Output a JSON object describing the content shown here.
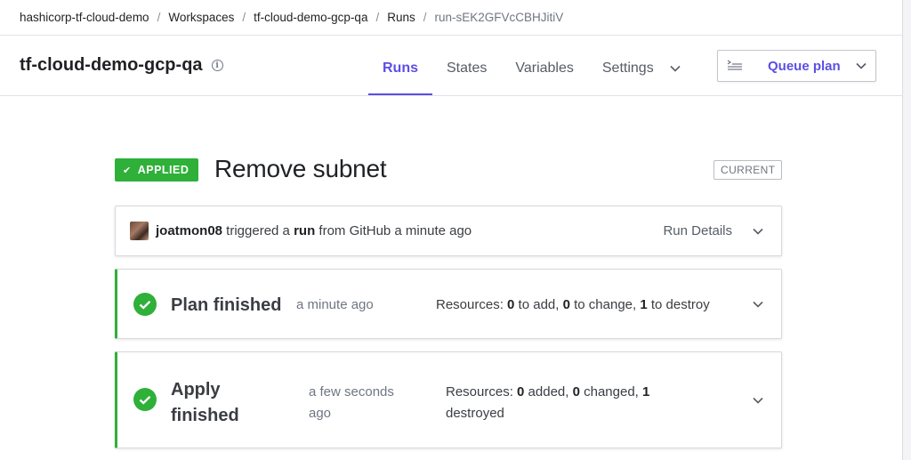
{
  "breadcrumb": {
    "org": "hashicorp-tf-cloud-demo",
    "workspaces": "Workspaces",
    "workspace": "tf-cloud-demo-gcp-qa",
    "runs": "Runs",
    "run_id": "run-sEK2GFVcCBHJitiV",
    "separator": "/"
  },
  "header": {
    "title": "tf-cloud-demo-gcp-qa",
    "info_icon": "info-icon",
    "tabs": [
      {
        "label": "Runs",
        "active": true
      },
      {
        "label": "States",
        "active": false
      },
      {
        "label": "Variables",
        "active": false
      },
      {
        "label": "Settings",
        "active": false
      }
    ],
    "queue_button": "Queue plan"
  },
  "run": {
    "status_badge": "APPLIED",
    "title": "Remove subnet",
    "current_badge": "CURRENT",
    "trigger": {
      "user": "joatmon08",
      "text_1": " triggered a ",
      "run_word": "run",
      "text_2": " from GitHub a minute ago",
      "details_label": "Run Details"
    },
    "plan": {
      "title": "Plan finished",
      "time": "a minute ago",
      "res_prefix": "Resources: ",
      "add": "0",
      "add_label": " to add, ",
      "change": "0",
      "change_label": " to change, ",
      "destroy": "1",
      "destroy_label": " to destroy"
    },
    "apply": {
      "title_line1": "Apply",
      "title_line2": "finished",
      "time_line1": "a few seconds",
      "time_line2": "ago",
      "res_prefix": "Resources: ",
      "added": "0",
      "added_label": " added, ",
      "changed": "0",
      "changed_label": " changed, ",
      "destroyed": "1",
      "destroyed_label": "destroyed"
    }
  },
  "colors": {
    "accent": "#5c4ee5",
    "success": "#2eb039"
  }
}
